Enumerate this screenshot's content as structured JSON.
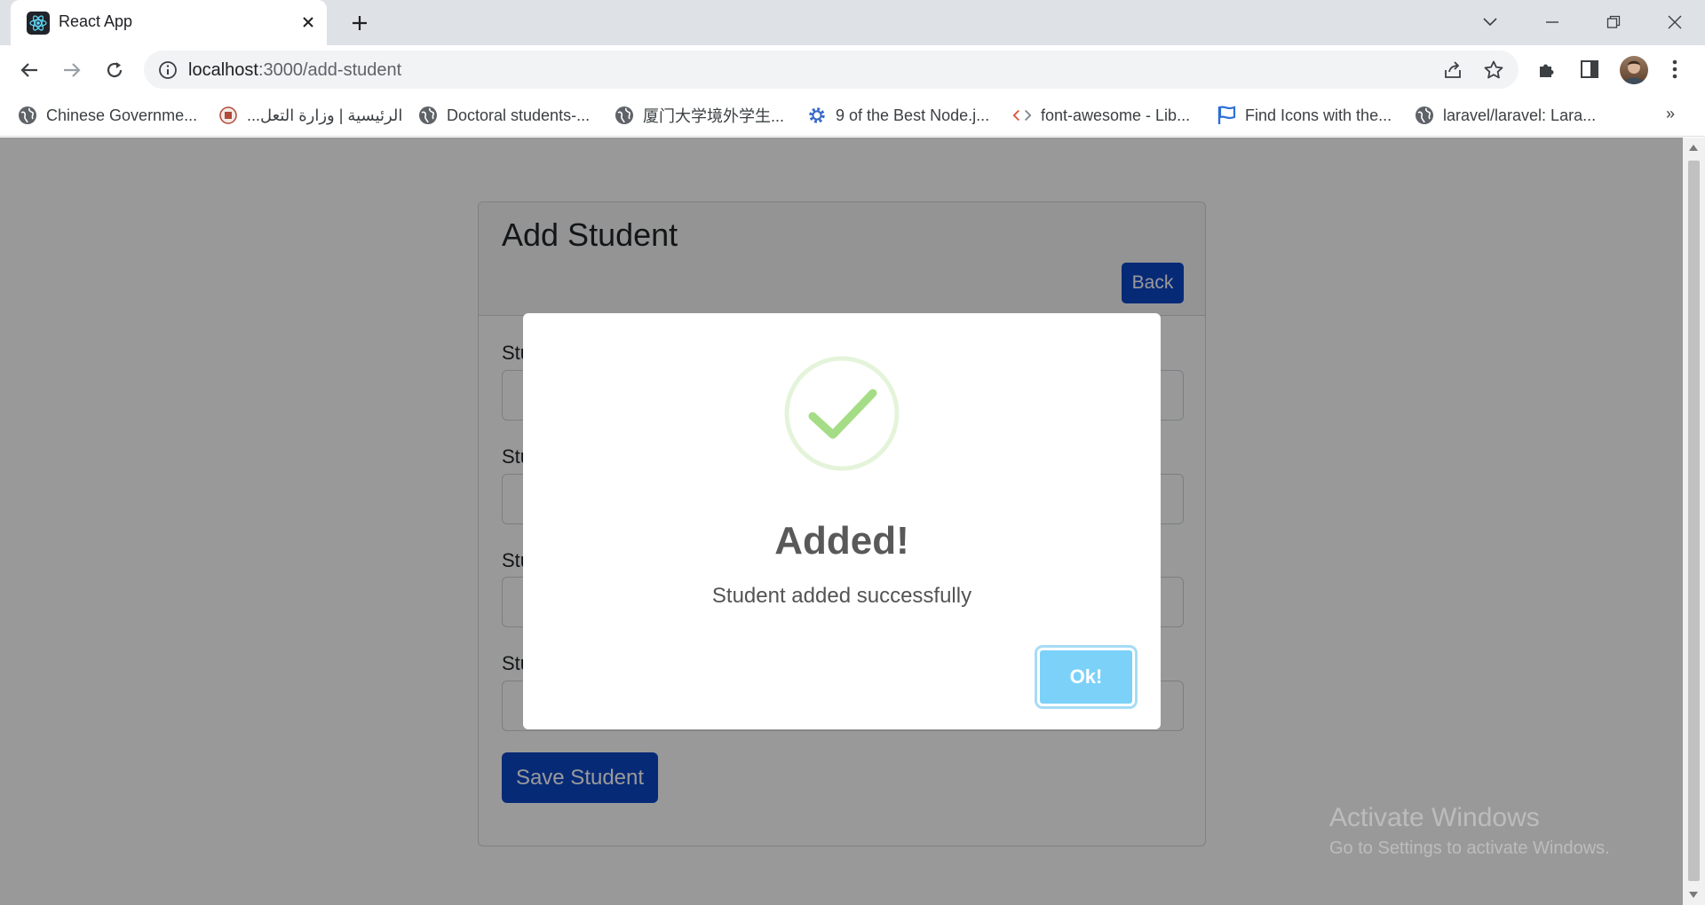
{
  "browser": {
    "tab_title": "React App",
    "url_host": "localhost",
    "url_path": ":3000/add-student",
    "bookmarks": [
      {
        "label": "Chinese Governme...",
        "icon": "globe-icon"
      },
      {
        "label": "الرئيسية | وزارة التعل...",
        "icon": "ministry-seal-icon"
      },
      {
        "label": "Doctoral students-...",
        "icon": "globe-icon"
      },
      {
        "label": "厦门大学境外学生...",
        "icon": "globe-icon"
      },
      {
        "label": "9 of the Best Node.j...",
        "icon": "gear-icon"
      },
      {
        "label": "font-awesome - Lib...",
        "icon": "code-icon"
      },
      {
        "label": "Find Icons with the...",
        "icon": "flag-icon"
      },
      {
        "label": "laravel/laravel: Lara...",
        "icon": "globe-icon"
      }
    ],
    "bookmarks_more": "»"
  },
  "page": {
    "card_title": "Add Student",
    "back_label": "Back",
    "field_labels": [
      "Stu",
      "Stu",
      "Stu",
      "Stu"
    ],
    "save_label": "Save Student"
  },
  "modal": {
    "title": "Added!",
    "text": "Student added successfully",
    "ok_label": "Ok!",
    "icon": "success-check-icon"
  },
  "watermark": {
    "title": "Activate Windows",
    "subtitle": "Go to Settings to activate Windows."
  },
  "colors": {
    "primary": "#0d47c6",
    "ok_button": "#7cd1f9",
    "success_green": "#a5dc86"
  }
}
